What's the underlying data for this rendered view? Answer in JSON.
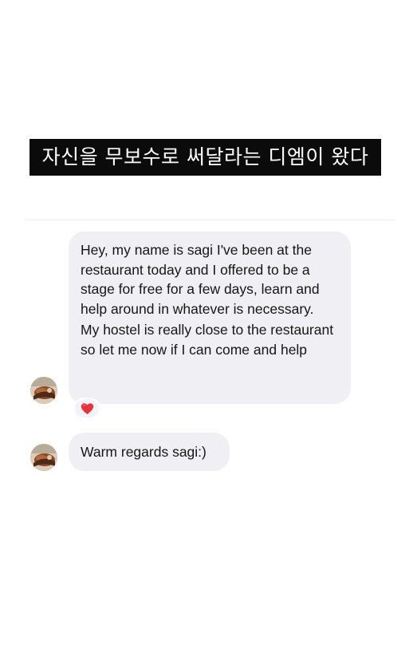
{
  "caption": {
    "text": "자신을 무보수로 써달라는 디엠이 왔다"
  },
  "conversation": {
    "messages": [
      {
        "sender": "sagi",
        "paragraphs": [
          "Hey, my name is sagi I've been at the restaurant today and I offered to be a stage for free for a few days, learn and help around in whatever is necessary.",
          "My hostel is really close to the restaurant so let me now if I can come and help"
        ],
        "reaction_icon": "red-heart-icon"
      },
      {
        "sender": "sagi",
        "text": "Warm regards sagi:)"
      }
    ]
  },
  "colors": {
    "caption_background": "#0b0b0b",
    "caption_text": "#ffffff",
    "bubble_background": "#efeff4",
    "reaction_heart": "#e8323c"
  }
}
